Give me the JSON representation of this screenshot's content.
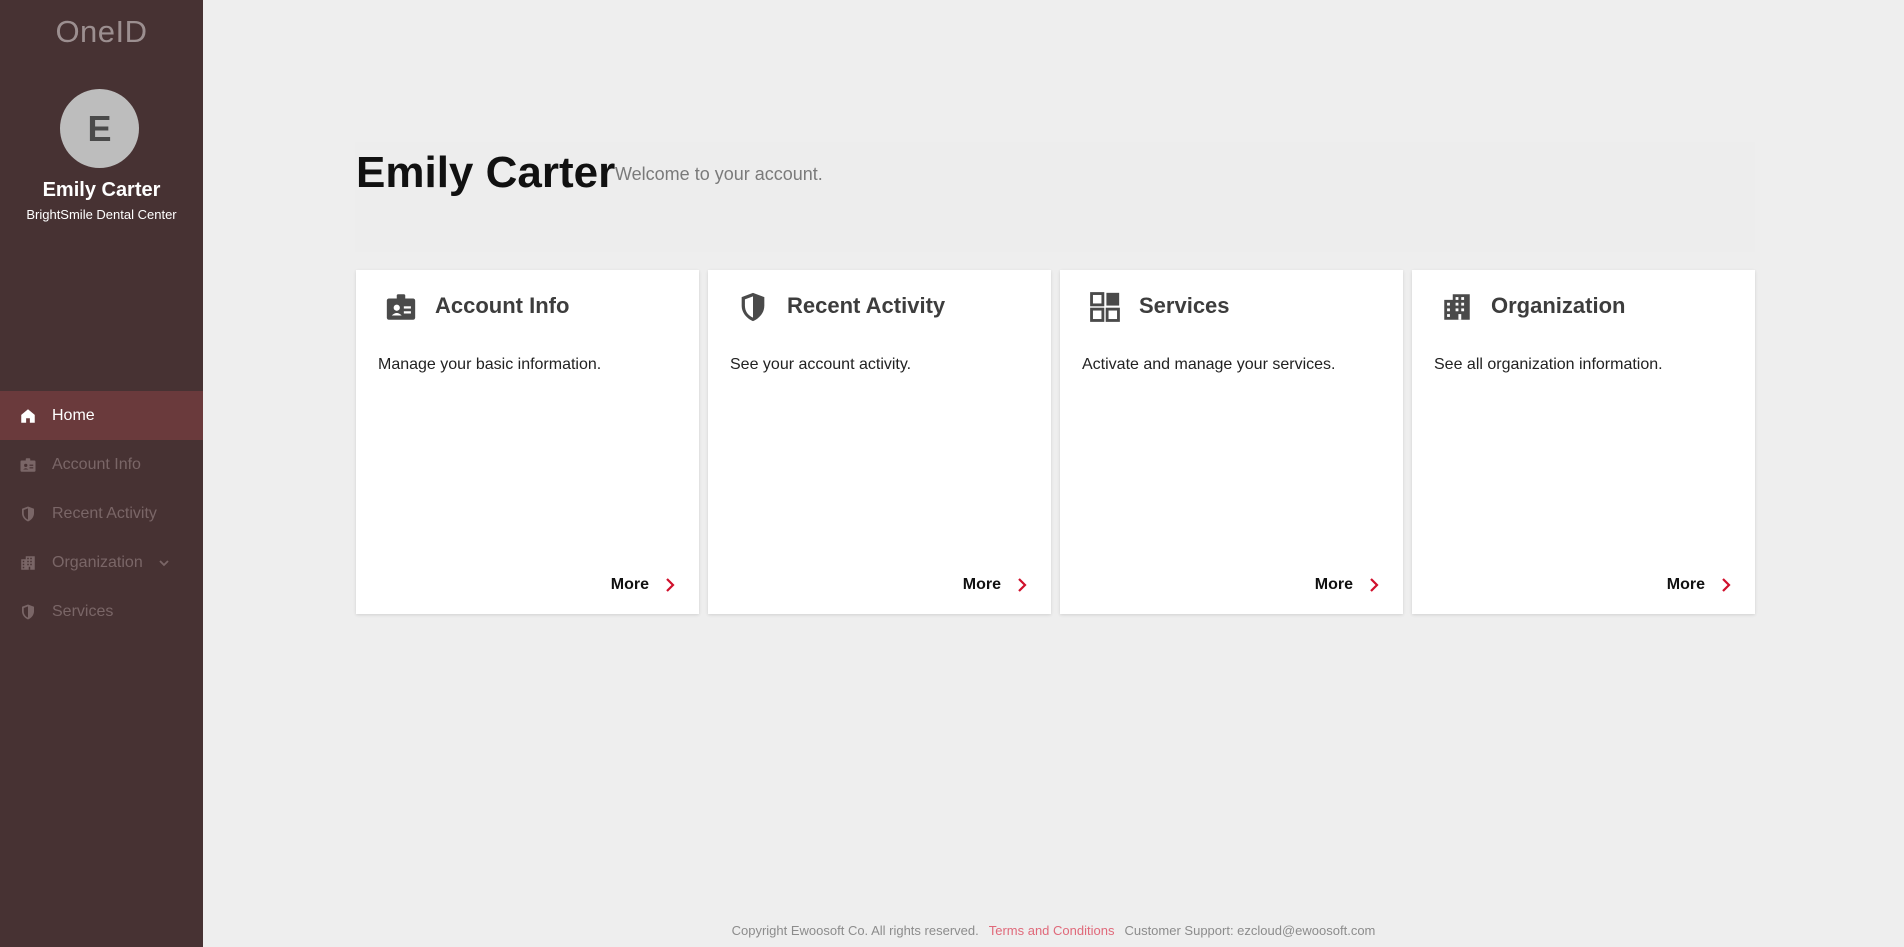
{
  "app": {
    "logo": "OneID"
  },
  "user": {
    "initial": "E",
    "name": "Emily Carter",
    "organization": "BrightSmile Dental Center"
  },
  "nav": {
    "items": [
      {
        "label": "Home",
        "icon": "home-icon",
        "active": true
      },
      {
        "label": "Account Info",
        "icon": "badge-icon",
        "active": false
      },
      {
        "label": "Recent Activity",
        "icon": "shield-icon",
        "active": false
      },
      {
        "label": "Organization",
        "icon": "building-icon",
        "active": false,
        "expandable": true
      },
      {
        "label": "Services",
        "icon": "shield-icon",
        "active": false
      }
    ]
  },
  "header": {
    "title": "Emily Carter",
    "subtitle": "Welcome to your account."
  },
  "cards": [
    {
      "title": "Account Info",
      "description": "Manage your basic information.",
      "icon": "badge-icon",
      "more": "More"
    },
    {
      "title": "Recent Activity",
      "description": "See your account activity.",
      "icon": "shield-icon",
      "more": "More"
    },
    {
      "title": "Services",
      "description": "Activate and manage your services.",
      "icon": "grid-icon",
      "more": "More"
    },
    {
      "title": "Organization",
      "description": "See all organization information.",
      "icon": "building-icon",
      "more": "More"
    }
  ],
  "footer": {
    "copyright": "Copyright Ewoosoft Co. All rights reserved.",
    "terms": "Terms and Conditions",
    "support": "Customer Support: ezcloud@ewoosoft.com"
  },
  "colors": {
    "sidebar_bg": "#473233",
    "active_nav_bg": "#6a3a3c",
    "accent": "#d0102c",
    "page_bg": "#eeeeee",
    "terms_link": "#e0697a"
  }
}
